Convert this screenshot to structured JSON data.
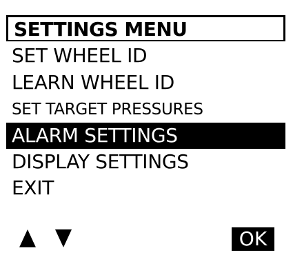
{
  "title": "SETTINGS MENU",
  "menu": {
    "items": [
      {
        "label": "SET WHEEL ID",
        "selected": false
      },
      {
        "label": "LEARN WHEEL ID",
        "selected": false
      },
      {
        "label": "SET TARGET PRESSURES",
        "selected": false
      },
      {
        "label": "ALARM SETTINGS",
        "selected": true
      },
      {
        "label": "DISPLAY SETTINGS",
        "selected": false
      },
      {
        "label": "EXIT",
        "selected": false
      }
    ]
  },
  "controls": {
    "up_icon": "up-triangle-icon",
    "down_icon": "down-triangle-icon",
    "ok_label": "OK"
  },
  "colors": {
    "foreground": "#000000",
    "background": "#ffffff",
    "selection_bg": "#000000",
    "selection_fg": "#ffffff"
  }
}
